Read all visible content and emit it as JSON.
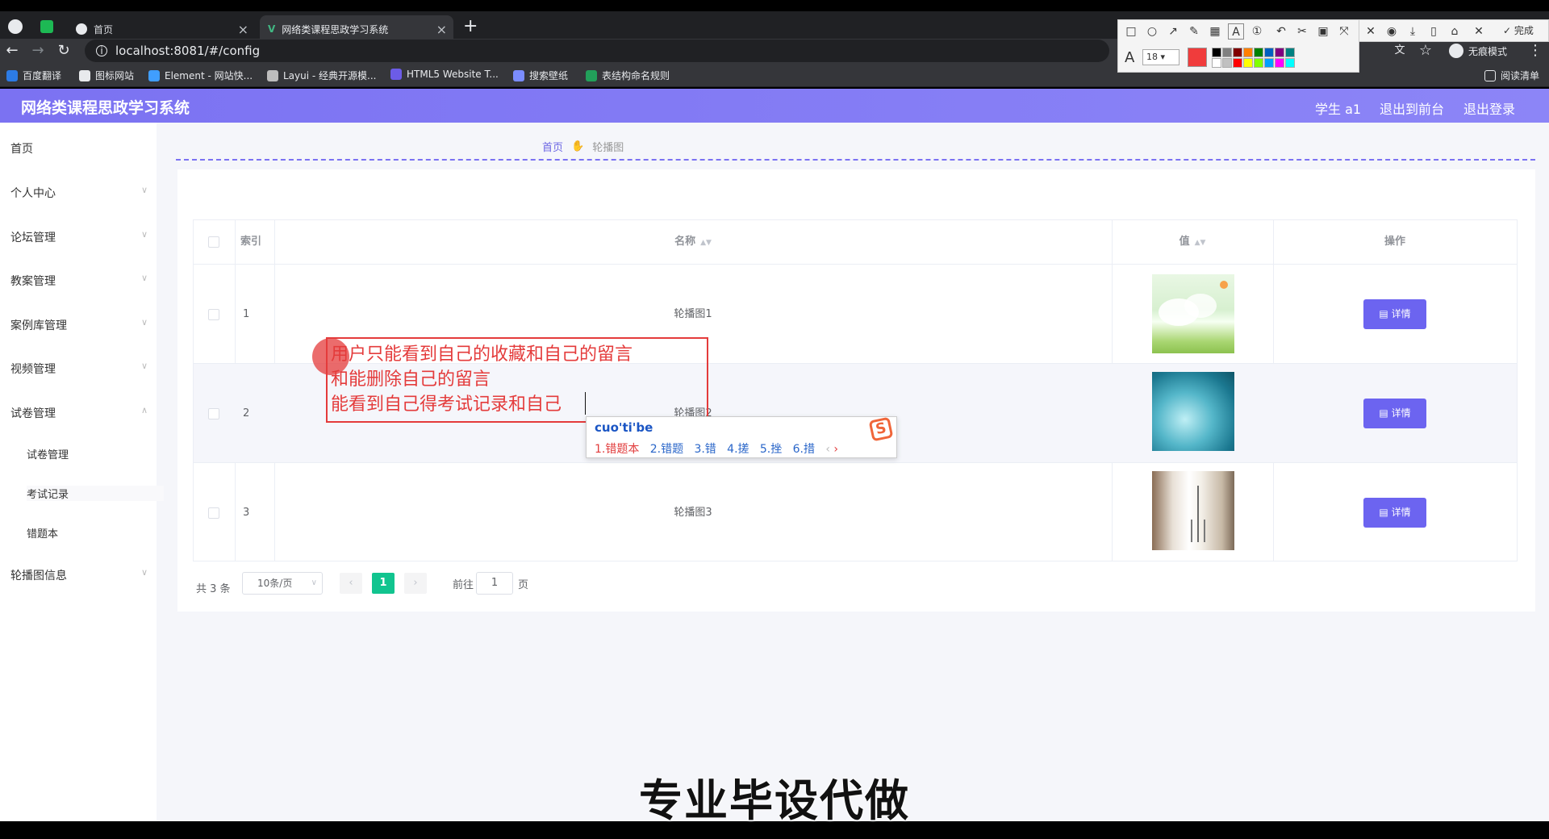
{
  "browser": {
    "tabs": [
      {
        "label": "首页"
      },
      {
        "label": "网络类课程思政学习系统"
      }
    ],
    "url": "localhost:8081/#/config",
    "bookmarks": [
      "百度翻译",
      "图标网站",
      "Element - 网站快...",
      "Layui - 经典开源模...",
      "HTML5 Website T...",
      "搜索壁纸",
      "表结构命名规则"
    ],
    "right_labels": {
      "incognito": "无痕模式",
      "reading_list": "阅读清单"
    }
  },
  "annotation_tool": {
    "font_size": "18",
    "done_label": "完成",
    "colors": [
      "#f03c3c",
      "#000000",
      "#808080",
      "#800000",
      "#ff8000",
      "#008000",
      "#0060c0",
      "#800080",
      "#008080",
      "#ffffff",
      "#c0c0c0",
      "#ff0000",
      "#ffff00",
      "#80ff00",
      "#00a0ff",
      "#ff00ff",
      "#00ffff"
    ]
  },
  "header": {
    "title": "网络类课程思政学习系统",
    "user": "学生 a1",
    "to_front": "退出到前台",
    "logout": "退出登录"
  },
  "sidebar": {
    "items": [
      "首页",
      "个人中心",
      "论坛管理",
      "教案管理",
      "案例库管理",
      "视频管理",
      "试卷管理",
      "试卷管理",
      "考试记录",
      "错题本",
      "轮播图信息"
    ]
  },
  "breadcrumb": {
    "home": "首页",
    "current": "轮播图"
  },
  "table": {
    "headers": {
      "index": "索引",
      "name": "名称",
      "value": "值",
      "action": "操作"
    },
    "rows": [
      {
        "index": "1",
        "name": "轮播图1"
      },
      {
        "index": "2",
        "name": "轮播图2"
      },
      {
        "index": "3",
        "name": "轮播图3"
      }
    ],
    "detail_label": "详情"
  },
  "pagination": {
    "total": "共 3 条",
    "page_size": "10条/页",
    "current": "1",
    "goto_prefix": "前往",
    "goto_value": "1",
    "goto_suffix": "页"
  },
  "overlay": {
    "note": "用户只能看到自己的收藏和自己的留言\n和能删除自己的留言\n能看到自己得考试记录和自己",
    "ime_composition": "cuo'ti'be",
    "ime_candidates": [
      "1.错题本",
      "2.错题",
      "3.错",
      "4.搓",
      "5.挫",
      "6.措"
    ]
  },
  "caption": "专业毕设代做"
}
